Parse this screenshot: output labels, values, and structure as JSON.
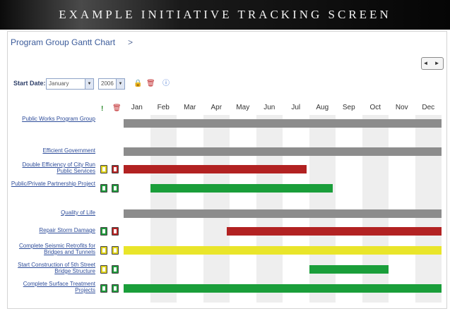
{
  "banner": {
    "title": "EXAMPLE INITIATIVE TRACKING SCREEN"
  },
  "breadcrumb": {
    "label": "Program Group Gantt Chart",
    "separator": ">"
  },
  "nav": {
    "arrows": "◄ ►"
  },
  "toolbar": {
    "start_date_label": "Start Date:",
    "month_value": "January",
    "year_value": "2006",
    "icons": [
      "lock-icon",
      "trash-icon",
      "info-icon"
    ]
  },
  "header_icons": [
    "exclamation-icon",
    "trash-icon"
  ],
  "months": [
    "Jan",
    "Feb",
    "Mar",
    "Apr",
    "May",
    "Jun",
    "Jul",
    "Aug",
    "Sep",
    "Oct",
    "Nov",
    "Dec"
  ],
  "colors": {
    "gray": "#8c8c8c",
    "red": "#b22222",
    "green": "#1a9e3a",
    "yellow": "#e9e52a"
  },
  "rows": [
    {
      "label": "Public Works Program Group",
      "status": [],
      "bar": {
        "color": "gray",
        "start_month": 1.0,
        "end_month": 13.0
      }
    },
    {
      "label": "Efficient Government",
      "status": [],
      "bar": {
        "color": "gray",
        "start_month": 1.0,
        "end_month": 13.0
      }
    },
    {
      "label": "Double Efficiency of City Run Public Services",
      "status": [
        "yellow",
        "red"
      ],
      "bar": {
        "color": "red",
        "start_month": 1.0,
        "end_month": 7.9
      }
    },
    {
      "label": "Public/Private Partnership Project",
      "status": [
        "green",
        "green"
      ],
      "bar": {
        "color": "green",
        "start_month": 2.0,
        "end_month": 8.9
      }
    },
    {
      "label": "Quality of Life",
      "status": [],
      "bar": {
        "color": "gray",
        "start_month": 1.0,
        "end_month": 13.0
      }
    },
    {
      "label": "Repair Storm Damage",
      "status": [
        "green",
        "red"
      ],
      "bar": {
        "color": "red",
        "start_month": 4.9,
        "end_month": 13.0
      }
    },
    {
      "label": "Complete Seismic Retrofits for Bridges and Tunnels",
      "status": [
        "yellow",
        "yellow"
      ],
      "bar": {
        "color": "yellow",
        "start_month": 1.0,
        "end_month": 13.0
      }
    },
    {
      "label": "Start Construction of 5th Street Bridge Structure",
      "status": [
        "yellow",
        "green"
      ],
      "bar": {
        "color": "green",
        "start_month": 8.0,
        "end_month": 11.0
      }
    },
    {
      "label": "Complete Surface Treatment Projects",
      "status": [
        "green",
        "green"
      ],
      "bar": {
        "color": "green",
        "start_month": 1.0,
        "end_month": 13.0
      }
    }
  ]
}
